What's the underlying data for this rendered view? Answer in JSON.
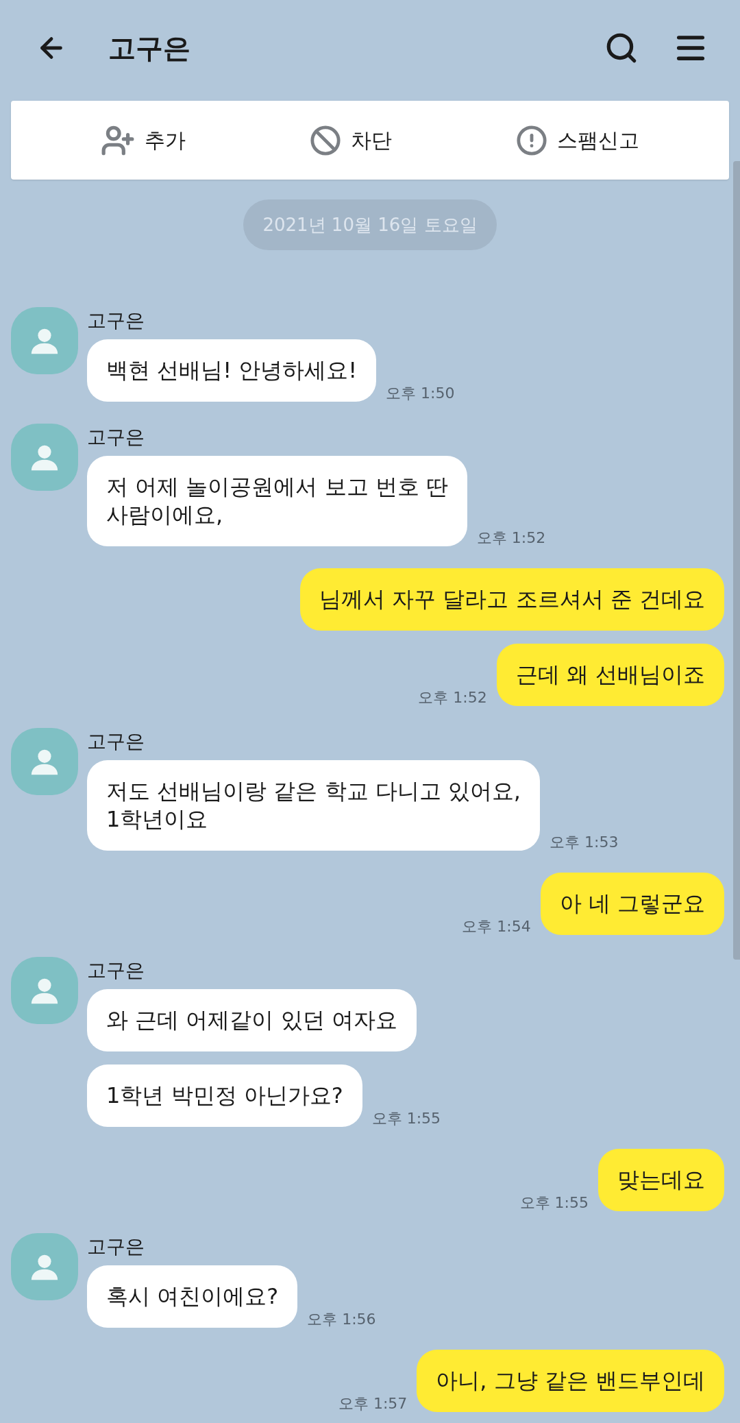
{
  "header": {
    "title": "고구은"
  },
  "actions": [
    {
      "kind": "add",
      "label": "추가"
    },
    {
      "kind": "block",
      "label": "차단"
    },
    {
      "kind": "report",
      "label": "스팸신고"
    }
  ],
  "date": "2021년 10월 16일 토요일",
  "messages": [
    {
      "kind": "received",
      "sender": "고구은",
      "bubbles": [
        {
          "text": "백현 선배님! 안녕하세요!",
          "time": "오후 1:50"
        }
      ]
    },
    {
      "kind": "received",
      "sender": "고구은",
      "bubbles": [
        {
          "text": "저 어제 놀이공원에서 보고 번호 딴\n사람이에요,",
          "time": "오후 1:52"
        }
      ]
    },
    {
      "kind": "sent",
      "bubbles": [
        {
          "text": "님께서 자꾸 달라고 조르셔서 준 건데요"
        },
        {
          "text": "근데 왜 선배님이죠",
          "time": "오후 1:52"
        }
      ]
    },
    {
      "kind": "received",
      "sender": "고구은",
      "bubbles": [
        {
          "text": "저도 선배님이랑 같은 학교 다니고 있어요,\n1학년이요",
          "time": "오후 1:53"
        }
      ]
    },
    {
      "kind": "sent",
      "bubbles": [
        {
          "text": "아 네 그렇군요",
          "time": "오후 1:54"
        }
      ]
    },
    {
      "kind": "received",
      "sender": "고구은",
      "bubbles": [
        {
          "text": "와 근데 어제같이 있던 여자요"
        },
        {
          "text": "1학년 박민정 아닌가요?",
          "time": "오후 1:55"
        }
      ]
    },
    {
      "kind": "sent",
      "bubbles": [
        {
          "text": "맞는데요",
          "time": "오후 1:55"
        }
      ]
    },
    {
      "kind": "received",
      "sender": "고구은",
      "bubbles": [
        {
          "text": "혹시 여친이에요?",
          "time": "오후 1:56"
        }
      ]
    },
    {
      "kind": "sent",
      "bubbles": [
        {
          "text": "아니, 그냥 같은 밴드부인데",
          "time": "오후 1:57"
        }
      ]
    }
  ]
}
